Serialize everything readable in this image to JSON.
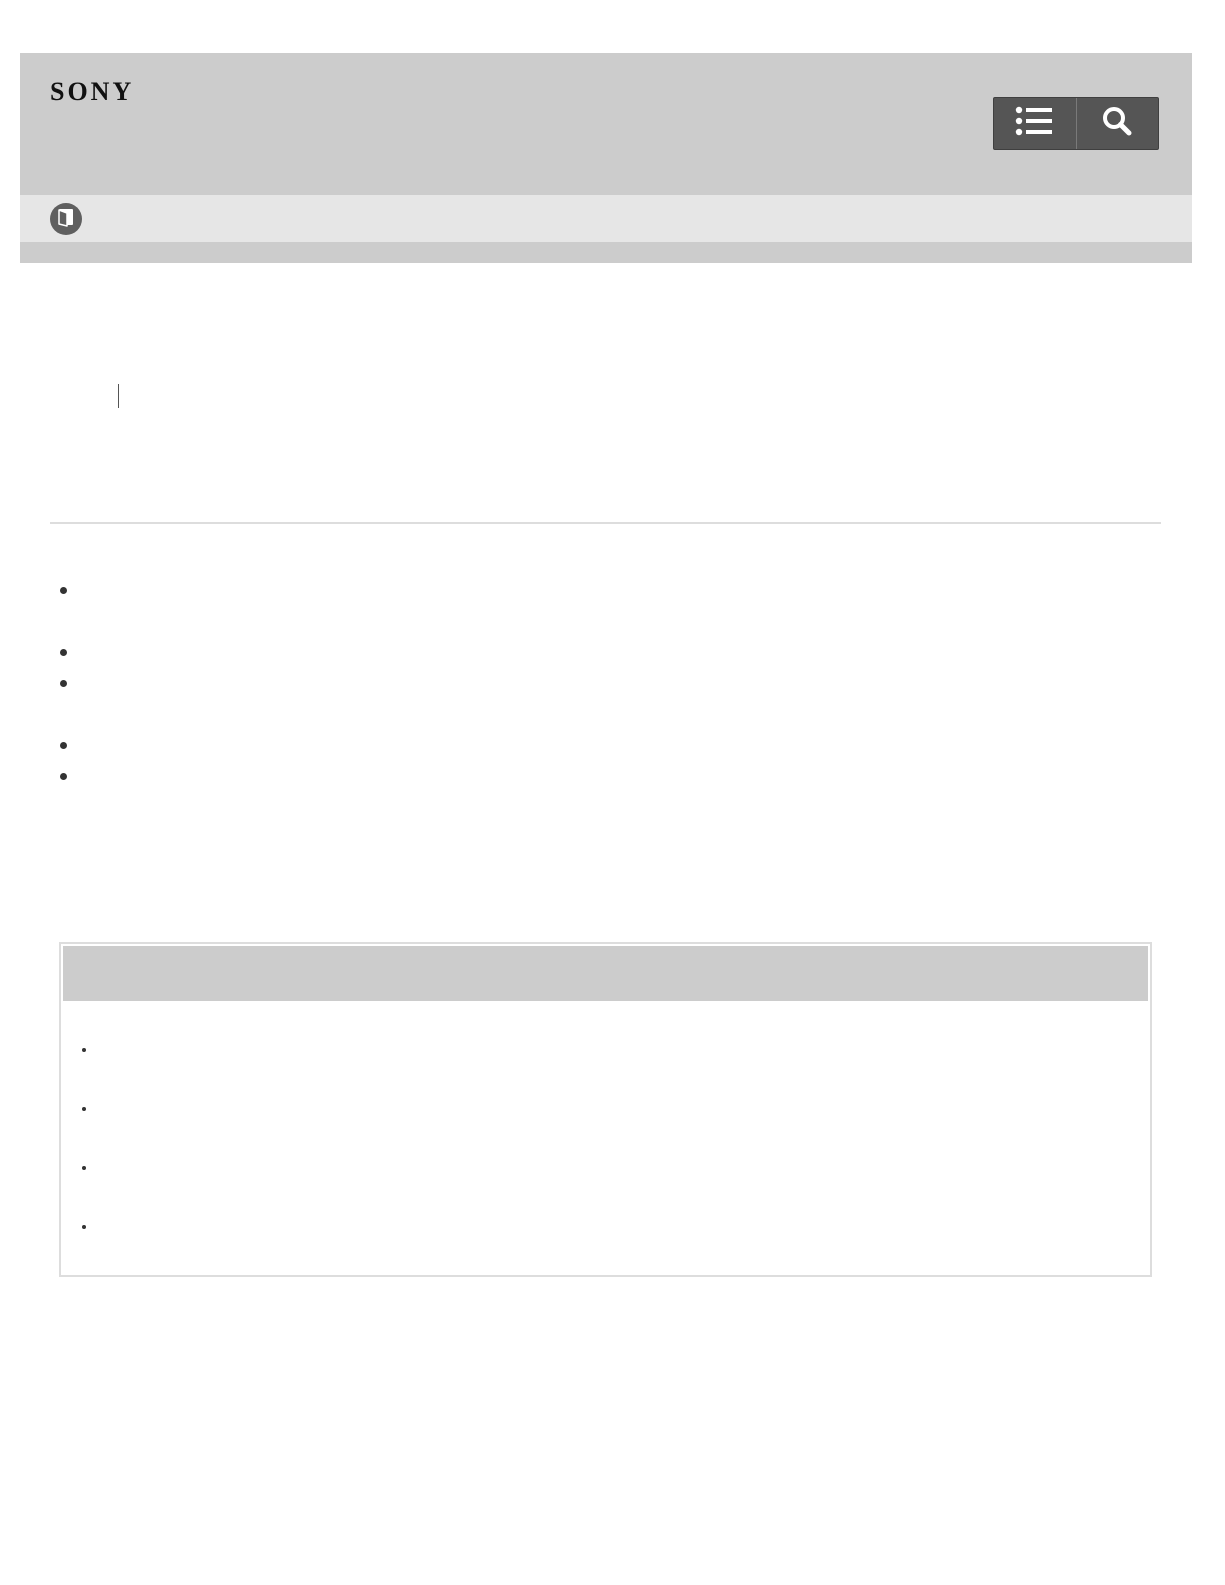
{
  "header": {
    "logo_text": "SONY",
    "toc_icon": "list-icon",
    "search_icon": "search-icon"
  },
  "breadcrumb": {
    "home_icon": "manual-book-icon"
  },
  "colors": {
    "header_bg": "#cccccc",
    "breadcrumb_bg": "#e6e6e6",
    "toolbar_bg": "#555555",
    "note_header_bg": "#cccccc"
  },
  "main": {
    "bullet_count": 5
  },
  "note": {
    "item_count": 4
  }
}
